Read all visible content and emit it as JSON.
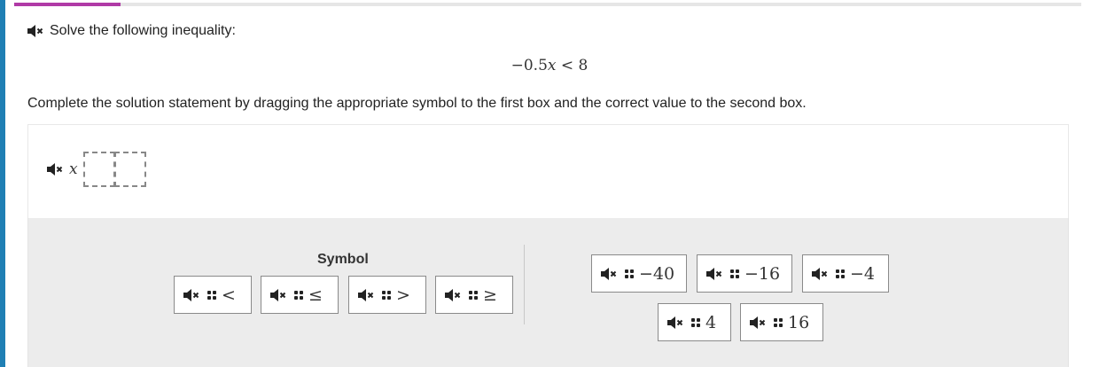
{
  "progress": {
    "fraction": 0.1
  },
  "prompt": "Solve the following inequality:",
  "inequality": {
    "coef": "−0.5",
    "var": "x",
    "rest": " < 8"
  },
  "instruction": "Complete the solution statement by dragging the appropriate symbol to the first box and the correct value to the second box.",
  "answer": {
    "variable": "x"
  },
  "tray": {
    "symbol_heading": "Symbol",
    "symbols": [
      "<",
      "≤",
      ">",
      "≥"
    ],
    "values": [
      "−40",
      "−16",
      "−4",
      "4",
      "16"
    ]
  },
  "colors": {
    "accent_bar": "#1f7fb4",
    "progress": "#b03aa6",
    "tray_bg": "#ececec"
  },
  "icons": {
    "audio": "speaker-muted-icon",
    "drag": "drag-grip-icon"
  }
}
